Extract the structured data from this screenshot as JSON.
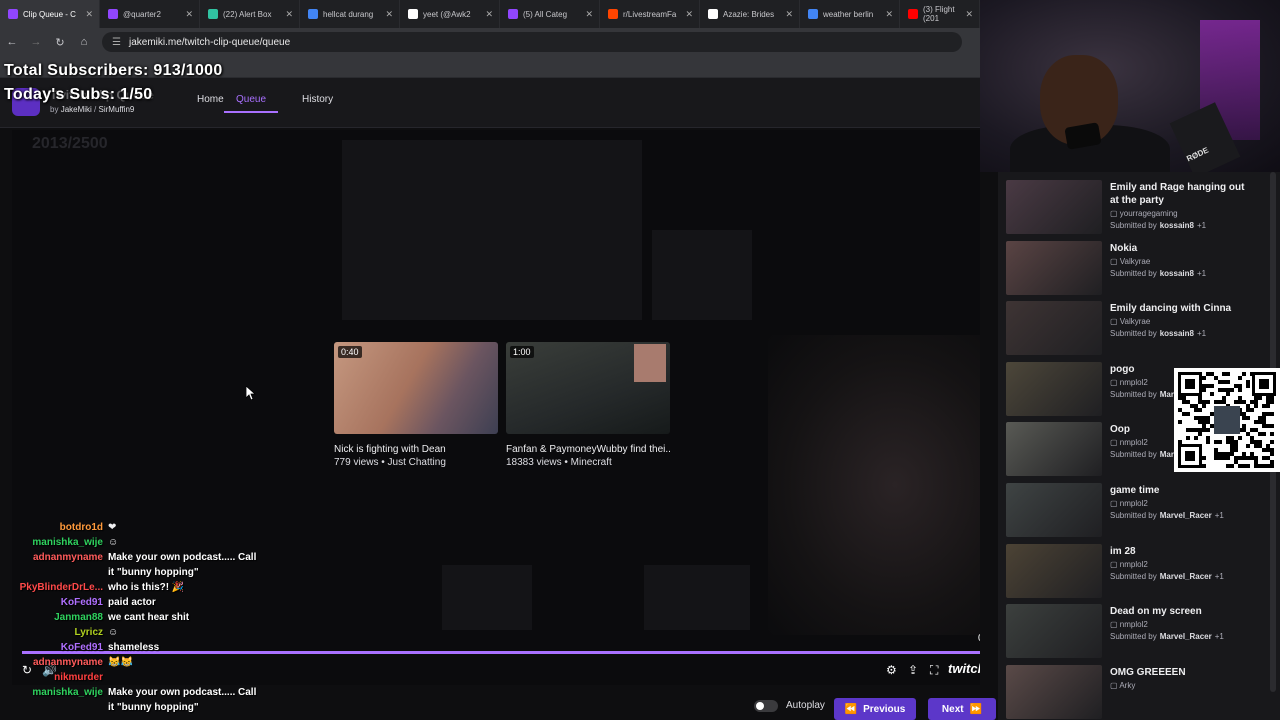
{
  "browser": {
    "tabs": [
      {
        "label": "Clip Queue - C",
        "color": "#9146ff",
        "active": true
      },
      {
        "label": "@quarter2",
        "color": "#9146ff"
      },
      {
        "label": "(22) Alert Box",
        "color": "#31c3a2"
      },
      {
        "label": "hellcat durang",
        "color": "#4285f4"
      },
      {
        "label": "yeet (@Awk2",
        "color": "#ffffff"
      },
      {
        "label": "(5) All Categ",
        "color": "#9146ff"
      },
      {
        "label": "r/LivestreamFa",
        "color": "#ff4500"
      },
      {
        "label": "Azazie: Brides",
        "color": "#ffffff"
      },
      {
        "label": "weather berlin",
        "color": "#4285f4"
      },
      {
        "label": "(3) Flight (201",
        "color": "#ff0000"
      }
    ],
    "url": "jakemiki.me/twitch-clip-queue/queue"
  },
  "overlay": {
    "total_subs": "Total Subscribers: 913/1000",
    "today_subs": "Today's Subs: 1/50",
    "ghost_count": "2013/2500"
  },
  "app": {
    "title": "Twitch Clip Queue",
    "by": "by",
    "author1": "JakeMiki",
    "sep": "/",
    "author2": "SirMuffin9",
    "nav": {
      "home": "Home",
      "queue": "Queue",
      "history": "History"
    }
  },
  "player": {
    "cards": [
      {
        "duration": "0:40",
        "title": "Nick is fighting with Dean",
        "meta": "779 views • Just Chatting"
      },
      {
        "duration": "1:00",
        "title": "Fanfan & PaymoneyWubby find thei...",
        "meta": "18383 views • Minecraft"
      }
    ],
    "counter": "0",
    "twitch_logo": "twitch",
    "autoplay_label": "Autoplay",
    "previous_label": "Previous",
    "next_label": "Next"
  },
  "chat": [
    {
      "user": "botdro1d",
      "color": "#ff9a3c",
      "msg": "",
      "emote": "❤"
    },
    {
      "user": "manishka_wije",
      "color": "#2fd35f",
      "msg": "",
      "emote": "☺"
    },
    {
      "user": "adnanmyname",
      "color": "#ff5b5b",
      "msg": "Make your own podcast..... Call"
    },
    {
      "user": "",
      "color": "#ffffff",
      "msg": "it \"bunny hopping\""
    },
    {
      "user": "PkyBlinderDrLe...",
      "color": "#ff4a4a",
      "msg": "who is this?! 🎉"
    },
    {
      "user": "KoFed91",
      "color": "#b070ff",
      "msg": "paid actor"
    },
    {
      "user": "Janman88",
      "color": "#2fd35f",
      "msg": "we cant hear shit"
    },
    {
      "user": "Lyricz",
      "color": "#b0d020",
      "msg": "",
      "emote": "☺"
    },
    {
      "user": "KoFed91",
      "color": "#b070ff",
      "msg": "shameless"
    },
    {
      "user": "adnanmyname",
      "color": "#ff5b5b",
      "msg": "",
      "emote": "😹😹"
    },
    {
      "user": "nikmurder",
      "color": "#ff4040",
      "msg": ""
    },
    {
      "user": "manishka_wije",
      "color": "#2fd35f",
      "msg": "Make your own podcast..... Call"
    },
    {
      "user": "",
      "color": "#ffffff",
      "msg": "it \"bunny hopping\""
    }
  ],
  "queue": [
    {
      "title": "Emily and Rage hanging out at the party",
      "channel": "yourragegaming",
      "submitted": "Submitted by",
      "by": "kossain8",
      "plus": "+1",
      "thumb": "#4a3a44"
    },
    {
      "title": "Nokia",
      "channel": "Valkyrae",
      "submitted": "Submitted by",
      "by": "kossain8",
      "plus": "+1",
      "thumb": "#5a4444"
    },
    {
      "title": "Emily dancing with Cinna",
      "channel": "Valkyrae",
      "submitted": "Submitted by",
      "by": "kossain8",
      "plus": "+1",
      "thumb": "#3e3434"
    },
    {
      "title": "pogo",
      "channel": "nmplol2",
      "submitted": "Submitted by",
      "by": "Marvel_Racer",
      "plus": "+1",
      "thumb": "#4d473a"
    },
    {
      "title": "Oop",
      "channel": "nmplol2",
      "submitted": "Submitted by",
      "by": "Marvel_Racer",
      "plus": "+1",
      "thumb": "#595a55"
    },
    {
      "title": "game time",
      "channel": "nmplol2",
      "submitted": "Submitted by",
      "by": "Marvel_Racer",
      "plus": "+1",
      "thumb": "#3f4444"
    },
    {
      "title": "im 28",
      "channel": "nmplol2",
      "submitted": "Submitted by",
      "by": "Marvel_Racer",
      "plus": "+1",
      "thumb": "#4c4335"
    },
    {
      "title": "Dead on my screen",
      "channel": "nmplol2",
      "submitted": "Submitted by",
      "by": "Marvel_Racer",
      "plus": "+1",
      "thumb": "#3c403e"
    },
    {
      "title": "OMG GREEEEN",
      "channel": "Arky",
      "submitted": "",
      "by": "",
      "plus": "",
      "thumb": "#5a4a48"
    }
  ],
  "webcam": {
    "mic_brand": "RØDE"
  }
}
